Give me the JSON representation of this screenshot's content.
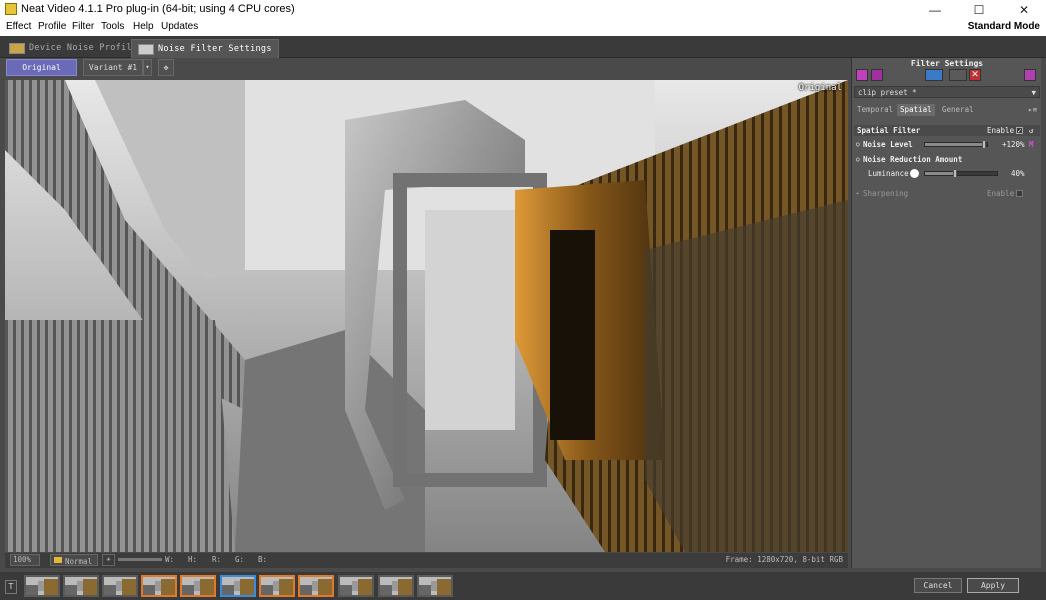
{
  "window": {
    "title": "Neat Video 4.1.1 Pro plug-in (64-bit; using 4 CPU cores)"
  },
  "menu": {
    "items": [
      "Effect",
      "Profile",
      "Filter",
      "Tools",
      "Help",
      "Updates"
    ],
    "mode": "Standard Mode"
  },
  "tabs": [
    "Device Noise Profile",
    "Noise Filter Settings"
  ],
  "viewer": {
    "original_btn": "Original",
    "variant_btn": "Variant #1",
    "overlay_label": "Original"
  },
  "status": {
    "zoom": "100%",
    "blend_mode": "Normal",
    "w": "W:",
    "h": "H:",
    "r": "R:",
    "g": "G:",
    "b": "B:",
    "frame": "Frame: 1280x720, 8-bit RGB"
  },
  "panel": {
    "title": "Filter Settings",
    "preset": "clip preset *",
    "tabs": [
      "Temporal",
      "Spatial",
      "General"
    ],
    "spatial_filter": {
      "label": "Spatial Filter",
      "enable": "Enable",
      "enable_check": "✓"
    },
    "noise_level": {
      "label": "Noise Level",
      "value": "+120%",
      "m": "M",
      "fraction": 0.92
    },
    "nra": {
      "label": "Noise Reduction Amount"
    },
    "luminance": {
      "label": "Luminance",
      "value": "40%",
      "fraction": 0.4
    },
    "sharpening": {
      "label": "Sharpening",
      "enable": "Enable"
    }
  },
  "buttons": {
    "cancel": "Cancel",
    "apply": "Apply"
  },
  "colors": {
    "accent": "#6a6ab8",
    "thumb_selected_orange": "#e07a2a",
    "thumb_selected_blue": "#3a8ade"
  }
}
